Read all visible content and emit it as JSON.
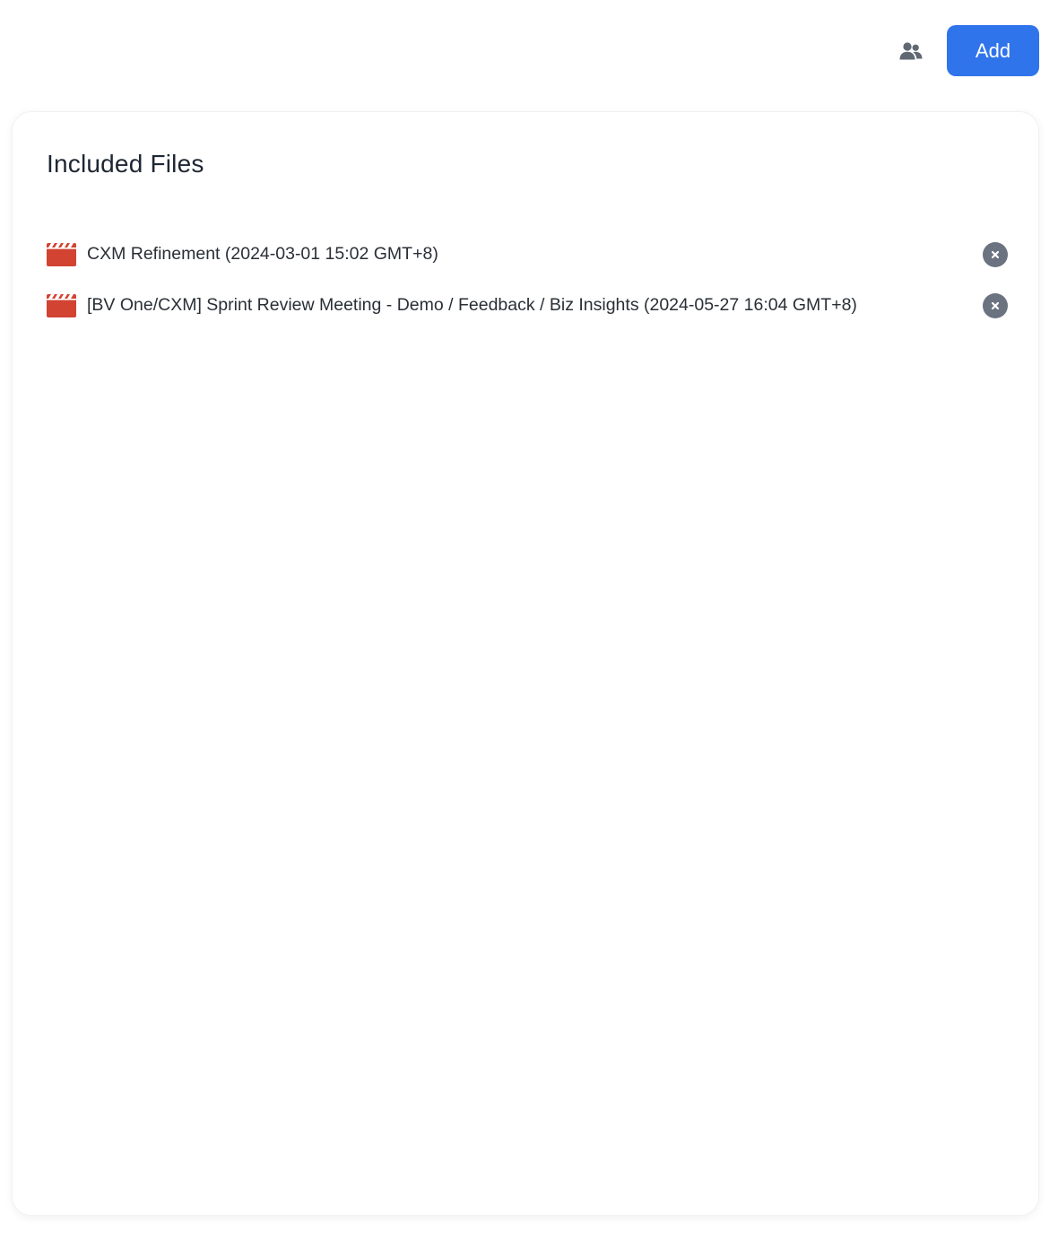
{
  "toolbar": {
    "share_icon": "people-icon",
    "add_label": "Add",
    "accent_color": "#2f74eb"
  },
  "panel": {
    "title": "Included Files",
    "files": [
      {
        "icon": "movie-clapperboard-icon",
        "name": "CXM Refinement (2024-03-01 15:02 GMT+8)",
        "remove_icon": "close-circle-icon"
      },
      {
        "icon": "movie-clapperboard-icon",
        "name": "[BV One/CXM] Sprint Review Meeting - Demo / Feedback / Biz Insights (2024-05-27 16:04 GMT+8)",
        "remove_icon": "close-circle-icon"
      }
    ]
  },
  "colors": {
    "video_icon": "#d24332",
    "remove_icon": "#6b7280"
  }
}
